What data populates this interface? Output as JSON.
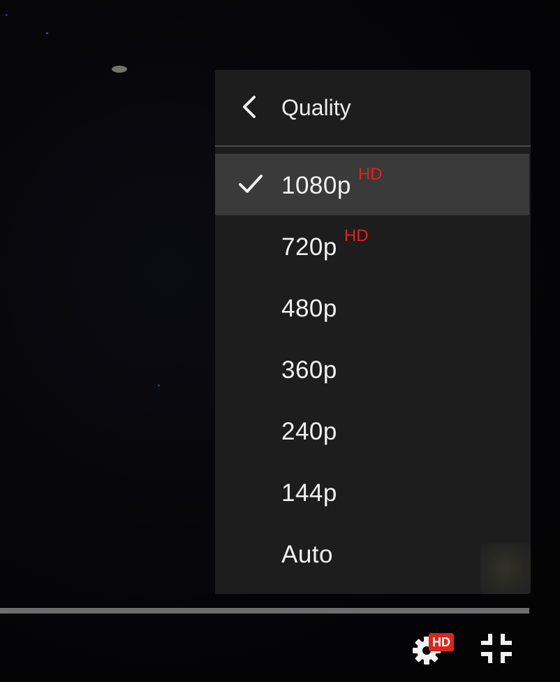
{
  "menu": {
    "title": "Quality",
    "back_icon": "chevron-left-icon",
    "items": [
      {
        "label": "1080p",
        "badge": "HD",
        "selected": true
      },
      {
        "label": "720p",
        "badge": "HD",
        "selected": false
      },
      {
        "label": "480p",
        "badge": "",
        "selected": false
      },
      {
        "label": "360p",
        "badge": "",
        "selected": false
      },
      {
        "label": "240p",
        "badge": "",
        "selected": false
      },
      {
        "label": "144p",
        "badge": "",
        "selected": false
      },
      {
        "label": "Auto",
        "badge": "",
        "selected": false
      }
    ]
  },
  "controls": {
    "settings_icon": "gear-icon",
    "settings_badge": "HD",
    "exit_fullscreen_icon": "exit-fullscreen-icon"
  },
  "colors": {
    "accent_red": "#e2231a",
    "menu_bg": "#1e1e1e",
    "selected_bg": "#3a3a3a",
    "text": "#f1f1f1"
  }
}
